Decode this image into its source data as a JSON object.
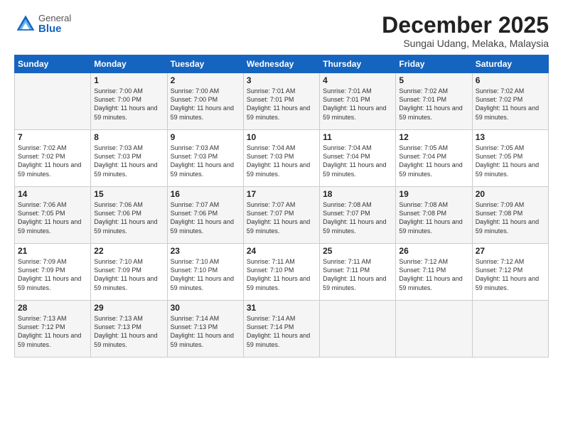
{
  "logo": {
    "general": "General",
    "blue": "Blue"
  },
  "title": "December 2025",
  "location": "Sungai Udang, Melaka, Malaysia",
  "days_header": [
    "Sunday",
    "Monday",
    "Tuesday",
    "Wednesday",
    "Thursday",
    "Friday",
    "Saturday"
  ],
  "weeks": [
    [
      {
        "day": "",
        "content": ""
      },
      {
        "day": "1",
        "content": "Sunrise: 7:00 AM\nSunset: 7:00 PM\nDaylight: 11 hours\nand 59 minutes."
      },
      {
        "day": "2",
        "content": "Sunrise: 7:00 AM\nSunset: 7:00 PM\nDaylight: 11 hours\nand 59 minutes."
      },
      {
        "day": "3",
        "content": "Sunrise: 7:01 AM\nSunset: 7:01 PM\nDaylight: 11 hours\nand 59 minutes."
      },
      {
        "day": "4",
        "content": "Sunrise: 7:01 AM\nSunset: 7:01 PM\nDaylight: 11 hours\nand 59 minutes."
      },
      {
        "day": "5",
        "content": "Sunrise: 7:02 AM\nSunset: 7:01 PM\nDaylight: 11 hours\nand 59 minutes."
      },
      {
        "day": "6",
        "content": "Sunrise: 7:02 AM\nSunset: 7:02 PM\nDaylight: 11 hours\nand 59 minutes."
      }
    ],
    [
      {
        "day": "7",
        "content": "Sunrise: 7:02 AM\nSunset: 7:02 PM\nDaylight: 11 hours\nand 59 minutes."
      },
      {
        "day": "8",
        "content": "Sunrise: 7:03 AM\nSunset: 7:03 PM\nDaylight: 11 hours\nand 59 minutes."
      },
      {
        "day": "9",
        "content": "Sunrise: 7:03 AM\nSunset: 7:03 PM\nDaylight: 11 hours\nand 59 minutes."
      },
      {
        "day": "10",
        "content": "Sunrise: 7:04 AM\nSunset: 7:03 PM\nDaylight: 11 hours\nand 59 minutes."
      },
      {
        "day": "11",
        "content": "Sunrise: 7:04 AM\nSunset: 7:04 PM\nDaylight: 11 hours\nand 59 minutes."
      },
      {
        "day": "12",
        "content": "Sunrise: 7:05 AM\nSunset: 7:04 PM\nDaylight: 11 hours\nand 59 minutes."
      },
      {
        "day": "13",
        "content": "Sunrise: 7:05 AM\nSunset: 7:05 PM\nDaylight: 11 hours\nand 59 minutes."
      }
    ],
    [
      {
        "day": "14",
        "content": "Sunrise: 7:06 AM\nSunset: 7:05 PM\nDaylight: 11 hours\nand 59 minutes."
      },
      {
        "day": "15",
        "content": "Sunrise: 7:06 AM\nSunset: 7:06 PM\nDaylight: 11 hours\nand 59 minutes."
      },
      {
        "day": "16",
        "content": "Sunrise: 7:07 AM\nSunset: 7:06 PM\nDaylight: 11 hours\nand 59 minutes."
      },
      {
        "day": "17",
        "content": "Sunrise: 7:07 AM\nSunset: 7:07 PM\nDaylight: 11 hours\nand 59 minutes."
      },
      {
        "day": "18",
        "content": "Sunrise: 7:08 AM\nSunset: 7:07 PM\nDaylight: 11 hours\nand 59 minutes."
      },
      {
        "day": "19",
        "content": "Sunrise: 7:08 AM\nSunset: 7:08 PM\nDaylight: 11 hours\nand 59 minutes."
      },
      {
        "day": "20",
        "content": "Sunrise: 7:09 AM\nSunset: 7:08 PM\nDaylight: 11 hours\nand 59 minutes."
      }
    ],
    [
      {
        "day": "21",
        "content": "Sunrise: 7:09 AM\nSunset: 7:09 PM\nDaylight: 11 hours\nand 59 minutes."
      },
      {
        "day": "22",
        "content": "Sunrise: 7:10 AM\nSunset: 7:09 PM\nDaylight: 11 hours\nand 59 minutes."
      },
      {
        "day": "23",
        "content": "Sunrise: 7:10 AM\nSunset: 7:10 PM\nDaylight: 11 hours\nand 59 minutes."
      },
      {
        "day": "24",
        "content": "Sunrise: 7:11 AM\nSunset: 7:10 PM\nDaylight: 11 hours\nand 59 minutes."
      },
      {
        "day": "25",
        "content": "Sunrise: 7:11 AM\nSunset: 7:11 PM\nDaylight: 11 hours\nand 59 minutes."
      },
      {
        "day": "26",
        "content": "Sunrise: 7:12 AM\nSunset: 7:11 PM\nDaylight: 11 hours\nand 59 minutes."
      },
      {
        "day": "27",
        "content": "Sunrise: 7:12 AM\nSunset: 7:12 PM\nDaylight: 11 hours\nand 59 minutes."
      }
    ],
    [
      {
        "day": "28",
        "content": "Sunrise: 7:13 AM\nSunset: 7:12 PM\nDaylight: 11 hours\nand 59 minutes."
      },
      {
        "day": "29",
        "content": "Sunrise: 7:13 AM\nSunset: 7:13 PM\nDaylight: 11 hours\nand 59 minutes."
      },
      {
        "day": "30",
        "content": "Sunrise: 7:14 AM\nSunset: 7:13 PM\nDaylight: 11 hours\nand 59 minutes."
      },
      {
        "day": "31",
        "content": "Sunrise: 7:14 AM\nSunset: 7:14 PM\nDaylight: 11 hours\nand 59 minutes."
      },
      {
        "day": "",
        "content": ""
      },
      {
        "day": "",
        "content": ""
      },
      {
        "day": "",
        "content": ""
      }
    ]
  ]
}
